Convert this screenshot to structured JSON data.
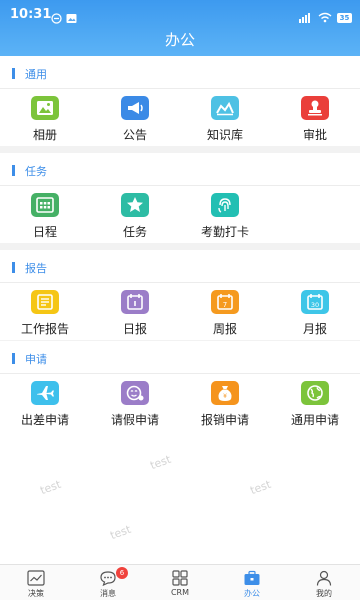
{
  "status_bar": {
    "time": "10:31",
    "battery": "35"
  },
  "header": {
    "title": "办公"
  },
  "sections": [
    {
      "title": "通用",
      "items": [
        {
          "label": "相册",
          "icon": "photo-album-icon",
          "color": "#7cc43b"
        },
        {
          "label": "公告",
          "icon": "megaphone-icon",
          "color": "#3b8ae6"
        },
        {
          "label": "知识库",
          "icon": "knowledge-base-icon",
          "color": "#4ec1e4"
        },
        {
          "label": "审批",
          "icon": "approval-stamp-icon",
          "color": "#ea3f3a"
        }
      ]
    },
    {
      "title": "任务",
      "items": [
        {
          "label": "日程",
          "icon": "calendar-grid-icon",
          "color": "#45b065"
        },
        {
          "label": "任务",
          "icon": "star-icon",
          "color": "#2dbca4"
        },
        {
          "label": "考勤打卡",
          "icon": "fingerprint-icon",
          "color": "#22bfb3"
        }
      ]
    },
    {
      "title": "报告",
      "items": [
        {
          "label": "工作报告",
          "icon": "work-report-icon",
          "color": "#f5c615"
        },
        {
          "label": "日报",
          "icon": "daily-report-icon",
          "color": "#9b7dc8"
        },
        {
          "label": "周报",
          "icon": "weekly-report-icon",
          "color": "#f59a1f"
        },
        {
          "label": "月报",
          "icon": "monthly-report-icon",
          "color": "#3ec6e8"
        }
      ]
    },
    {
      "title": "申请",
      "items": [
        {
          "label": "出差申请",
          "icon": "airplane-icon",
          "color": "#3ec0ec"
        },
        {
          "label": "请假申请",
          "icon": "leave-request-icon",
          "color": "#9b7dc8"
        },
        {
          "label": "报销申请",
          "icon": "money-bag-icon",
          "color": "#f5941d"
        },
        {
          "label": "通用申请",
          "icon": "globe-icon",
          "color": "#7cc43b"
        }
      ]
    }
  ],
  "report_icon_text": {
    "weekly": "7",
    "monthly": "30"
  },
  "watermark_text": "test",
  "tabbar": [
    {
      "label": "决策",
      "icon": "chart-icon",
      "active": false
    },
    {
      "label": "消息",
      "icon": "chat-bubble-icon",
      "active": false,
      "badge": "6"
    },
    {
      "label": "CRM",
      "icon": "grid-apps-icon",
      "active": false
    },
    {
      "label": "办公",
      "icon": "briefcase-icon",
      "active": true
    },
    {
      "label": "我的",
      "icon": "user-icon",
      "active": false
    }
  ],
  "colors": {
    "accent": "#3d8ee8",
    "header_top": "#3d9aef",
    "header_bottom": "#5cb3f6",
    "badge": "#f0423c"
  }
}
